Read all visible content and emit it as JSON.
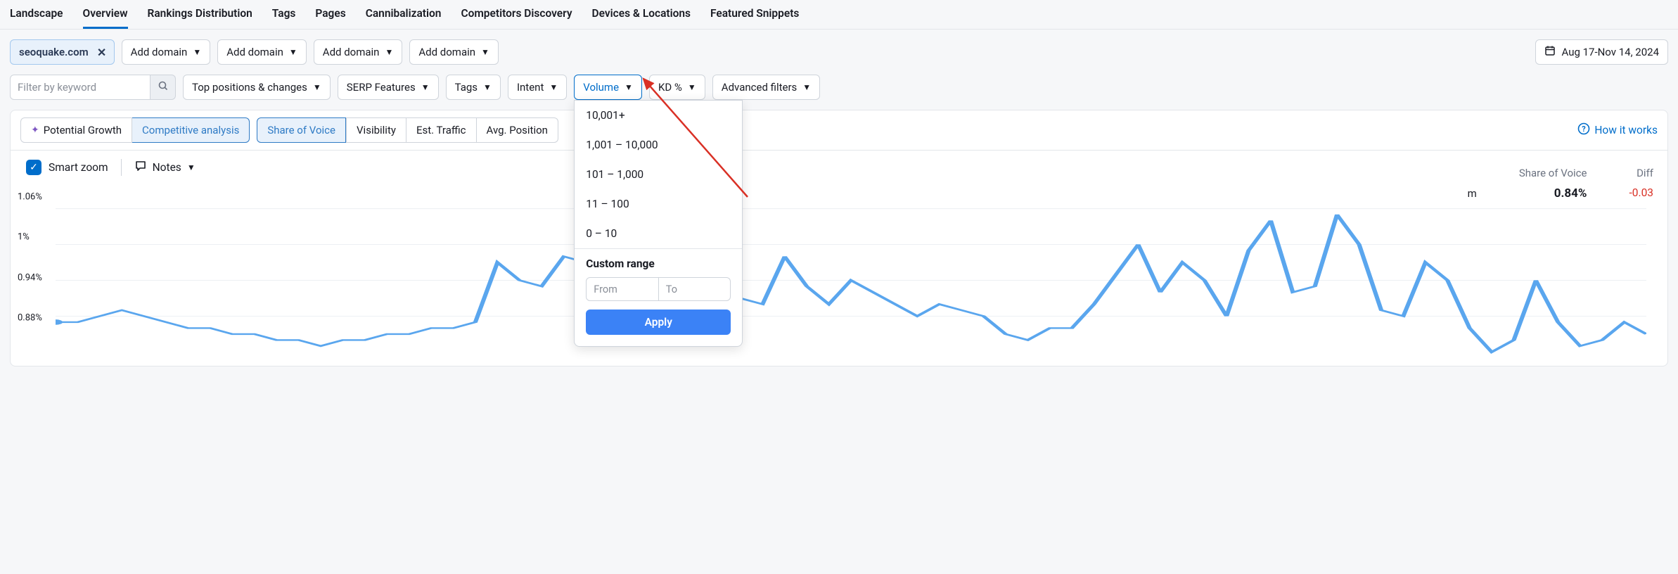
{
  "nav_tabs": [
    "Landscape",
    "Overview",
    "Rankings Distribution",
    "Tags",
    "Pages",
    "Cannibalization",
    "Competitors Discovery",
    "Devices & Locations",
    "Featured Snippets"
  ],
  "active_nav_index": 1,
  "domain_chip": "seoquake.com",
  "add_domain_label": "Add domain",
  "date_range": "Aug 17-Nov 14, 2024",
  "filter_keyword_placeholder": "Filter by keyword",
  "filters": {
    "top_positions": "Top positions & changes",
    "serp_features": "SERP Features",
    "tags": "Tags",
    "intent": "Intent",
    "volume": "Volume",
    "kd": "KD %",
    "advanced": "Advanced filters"
  },
  "sub_tabs_primary": [
    "Potential Growth",
    "Competitive analysis"
  ],
  "active_primary_index": 1,
  "sub_tabs_secondary": [
    "Share of Voice",
    "Visibility",
    "Est. Traffic",
    "Avg. Position"
  ],
  "active_secondary_index": 0,
  "how_it_works": "How it works",
  "smart_zoom": "Smart zoom",
  "notes": "Notes",
  "partial_domain_text": "m",
  "stats": {
    "sov_label": "Share of Voice",
    "sov_value": "0.84%",
    "diff_label": "Diff",
    "diff_value": "-0.03"
  },
  "volume_dropdown": {
    "options": [
      "10,001+",
      "1,001 – 10,000",
      "101 – 1,000",
      "11 – 100",
      "0 – 10"
    ],
    "custom_range_label": "Custom range",
    "from_placeholder": "From",
    "to_placeholder": "To",
    "apply_label": "Apply"
  },
  "chart_data": {
    "type": "line",
    "title": "",
    "xlabel": "",
    "ylabel": "",
    "ylim": [
      0.82,
      1.08
    ],
    "y_ticks": [
      "1.06%",
      "1%",
      "0.94%",
      "0.88%"
    ],
    "series": [
      {
        "name": "seoquake.com",
        "values": [
          0.87,
          0.87,
          0.88,
          0.89,
          0.88,
          0.87,
          0.86,
          0.86,
          0.85,
          0.85,
          0.84,
          0.84,
          0.83,
          0.84,
          0.84,
          0.85,
          0.85,
          0.86,
          0.86,
          0.87,
          0.97,
          0.94,
          0.93,
          0.98,
          0.97,
          0.88,
          0.94,
          0.96,
          1.02,
          0.97,
          0.92,
          0.91,
          0.9,
          0.98,
          0.93,
          0.9,
          0.94,
          0.92,
          0.9,
          0.88,
          0.9,
          0.89,
          0.88,
          0.85,
          0.84,
          0.86,
          0.86,
          0.9,
          0.95,
          1.0,
          0.92,
          0.97,
          0.94,
          0.88,
          0.99,
          1.04,
          0.92,
          0.93,
          1.05,
          1.0,
          0.89,
          0.88,
          0.97,
          0.94,
          0.86,
          0.82,
          0.84,
          0.94,
          0.87,
          0.83,
          0.84,
          0.87,
          0.85
        ]
      }
    ]
  }
}
